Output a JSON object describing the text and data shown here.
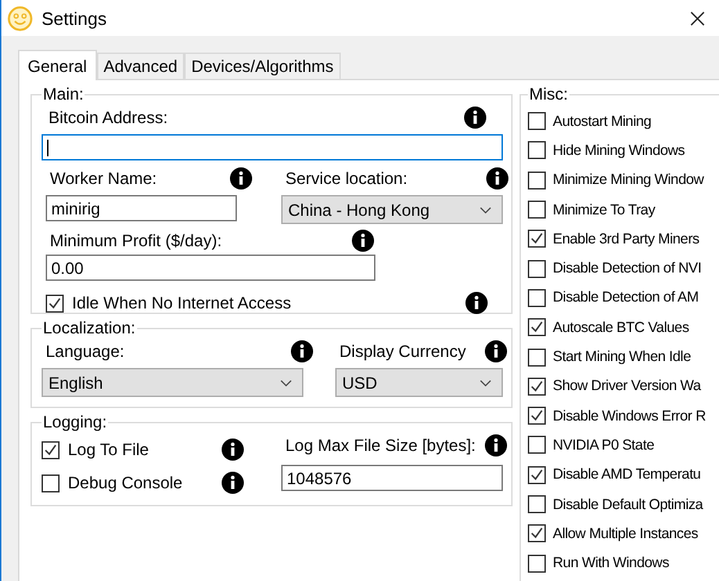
{
  "window": {
    "title": "Settings"
  },
  "tabs": [
    {
      "label": "General",
      "selected": true
    },
    {
      "label": "Advanced",
      "selected": false
    },
    {
      "label": "Devices/Algorithms",
      "selected": false
    }
  ],
  "main": {
    "legend": "Main:",
    "bitcoin_address": {
      "label": "Bitcoin Address:",
      "focused": true
    },
    "worker_name": {
      "label": "Worker Name:",
      "value": "minirig"
    },
    "service_location": {
      "label": "Service location:",
      "value": "China - Hong Kong"
    },
    "minimum_profit": {
      "label": "Minimum Profit ($/day):",
      "value": "0.00"
    },
    "idle_no_internet": {
      "label": "Idle When No Internet Access",
      "checked": true
    }
  },
  "localization": {
    "legend": "Localization:",
    "language": {
      "label": "Language:",
      "value": "English"
    },
    "display_currency": {
      "label": "Display Currency",
      "value": "USD"
    }
  },
  "logging": {
    "legend": "Logging:",
    "log_to_file": {
      "label": "Log To File",
      "checked": true
    },
    "debug_console": {
      "label": "Debug Console",
      "checked": false
    },
    "log_max_file_size": {
      "label": "Log Max File Size [bytes]:",
      "value": "1048576"
    }
  },
  "misc": {
    "legend": "Misc:",
    "items": [
      {
        "label": "Autostart Mining",
        "checked": false
      },
      {
        "label": "Hide Mining Windows",
        "checked": false
      },
      {
        "label": "Minimize Mining Window",
        "checked": false
      },
      {
        "label": "Minimize To Tray",
        "checked": false
      },
      {
        "label": "Enable 3rd Party Miners",
        "checked": true
      },
      {
        "label": "Disable Detection of NVI",
        "checked": false
      },
      {
        "label": "Disable Detection of AM",
        "checked": false
      },
      {
        "label": "Autoscale BTC Values",
        "checked": true
      },
      {
        "label": "Start Mining When Idle",
        "checked": false
      },
      {
        "label": "Show Driver Version Wa",
        "checked": true
      },
      {
        "label": "Disable Windows Error R",
        "checked": true
      },
      {
        "label": "NVIDIA P0 State",
        "checked": false
      },
      {
        "label": "Disable AMD Temperatu",
        "checked": true
      },
      {
        "label": "Disable Default Optimiza",
        "checked": false
      },
      {
        "label": "Allow Multiple Instances",
        "checked": true
      },
      {
        "label": "Run With Windows",
        "checked": false
      }
    ]
  }
}
